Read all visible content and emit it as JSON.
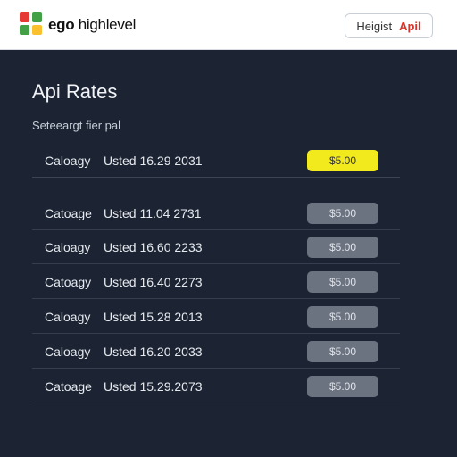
{
  "header": {
    "brand_bold": "ego",
    "brand_rest": " highlevel",
    "button_label": "Heigist",
    "button_accent": "Apil"
  },
  "page": {
    "title": "Api Rates",
    "subtitle": "Seteeargt fier pal"
  },
  "rows": [
    {
      "category": "Caloagy",
      "used": "Usted 16.29 2031",
      "price": "$5.00",
      "selected": true
    },
    {
      "category": "Catoage",
      "used": "Usted 11.04 2731",
      "price": "$5.00",
      "selected": false
    },
    {
      "category": "Caloagy",
      "used": "Usted 16.60 2233",
      "price": "$5.00",
      "selected": false
    },
    {
      "category": "Catoagy",
      "used": "Usted 16.40 2273",
      "price": "$5.00",
      "selected": false
    },
    {
      "category": "Caloagy",
      "used": "Usted 15.28 2013",
      "price": "$5.00",
      "selected": false
    },
    {
      "category": "Caloagy",
      "used": "Usted 16.20 2033",
      "price": "$5.00",
      "selected": false
    },
    {
      "category": "Catoage",
      "used": "Usted 15.29.2073",
      "price": "$5.00",
      "selected": false
    }
  ],
  "colors": {
    "accent": "#f2ea1d",
    "background": "#1c2433",
    "price_pill": "#6b7280",
    "logo": [
      "#e53935",
      "#43a047",
      "#fbc02d",
      "#1e88e5"
    ]
  }
}
